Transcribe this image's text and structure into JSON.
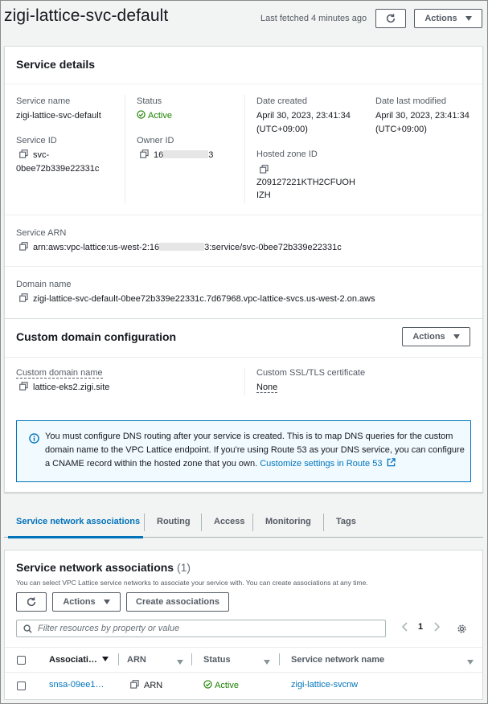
{
  "header": {
    "title": "zigi-lattice-svc-default",
    "last_fetched": "Last fetched 4 minutes ago",
    "actions_label": "Actions"
  },
  "service_details": {
    "section_title": "Service details",
    "service_name_label": "Service name",
    "service_name": "zigi-lattice-svc-default",
    "service_id_label": "Service ID",
    "service_id_line1": "svc-",
    "service_id_line2": "0bee72b339e22331c",
    "status_label": "Status",
    "status": "Active",
    "owner_id_label": "Owner ID",
    "owner_id_start": "16",
    "owner_id_end": "3",
    "date_created_label": "Date created",
    "date_created_line1": "April 30, 2023, 23:41:34",
    "date_created_line2": "(UTC+09:00)",
    "hosted_zone_label": "Hosted zone ID",
    "hosted_zone_line1": "Z09127221KTH2CFUOH",
    "hosted_zone_line2": "IZH",
    "date_modified_label": "Date last modified",
    "date_modified_line1": "April 30, 2023, 23:41:34",
    "date_modified_line2": "(UTC+09:00)",
    "arn_label": "Service ARN",
    "arn_start": "arn:aws:vpc-lattice:us-west-2:16",
    "arn_end": "3:service/svc-0bee72b339e22331c",
    "domain_label": "Domain name",
    "domain": "zigi-lattice-svc-default-0bee72b339e22331c.7d67968.vpc-lattice-svcs.us-west-2.on.aws"
  },
  "custom_domain": {
    "section_title": "Custom domain configuration",
    "actions_label": "Actions",
    "name_label": "Custom domain name",
    "name": "lattice-eks2.zigi.site",
    "cert_label": "Custom SSL/TLS certificate",
    "cert": "None"
  },
  "alert": {
    "text": "You must configure DNS routing after your service is created. This is to map DNS queries for the custom domain name to the VPC Lattice endpoint. If you're using Route 53 as your DNS service, you can configure a CNAME record within the hosted zone that you own.",
    "link": "Customize settings in Route 53"
  },
  "tabs": [
    {
      "label": "Service network associations"
    },
    {
      "label": "Routing"
    },
    {
      "label": "Access"
    },
    {
      "label": "Monitoring"
    },
    {
      "label": "Tags"
    }
  ],
  "associations": {
    "title": "Service network associations",
    "count": "(1)",
    "description": "You can select VPC Lattice service networks to associate your service with. You can create associations at any time.",
    "actions_label": "Actions",
    "create_label": "Create associations",
    "search_placeholder": "Filter resources by property or value",
    "page": "1",
    "columns": [
      "Associati…",
      "ARN",
      "Status",
      "Service network name"
    ],
    "rows": [
      {
        "id": "snsa-09ee1…",
        "arn": "ARN",
        "status": "Active",
        "network": "zigi-lattice-svcnw"
      }
    ]
  },
  "colors": {
    "accent": "#0073bb",
    "success": "#1d8102",
    "text": "#16191f",
    "muted": "#545b64"
  },
  "icons": [
    "refresh-icon",
    "copy-icon",
    "check-circle-icon",
    "info-icon",
    "external-link-icon",
    "search-icon",
    "chevron-left-icon",
    "chevron-right-icon",
    "settings-gear-icon",
    "caret-down-icon"
  ]
}
